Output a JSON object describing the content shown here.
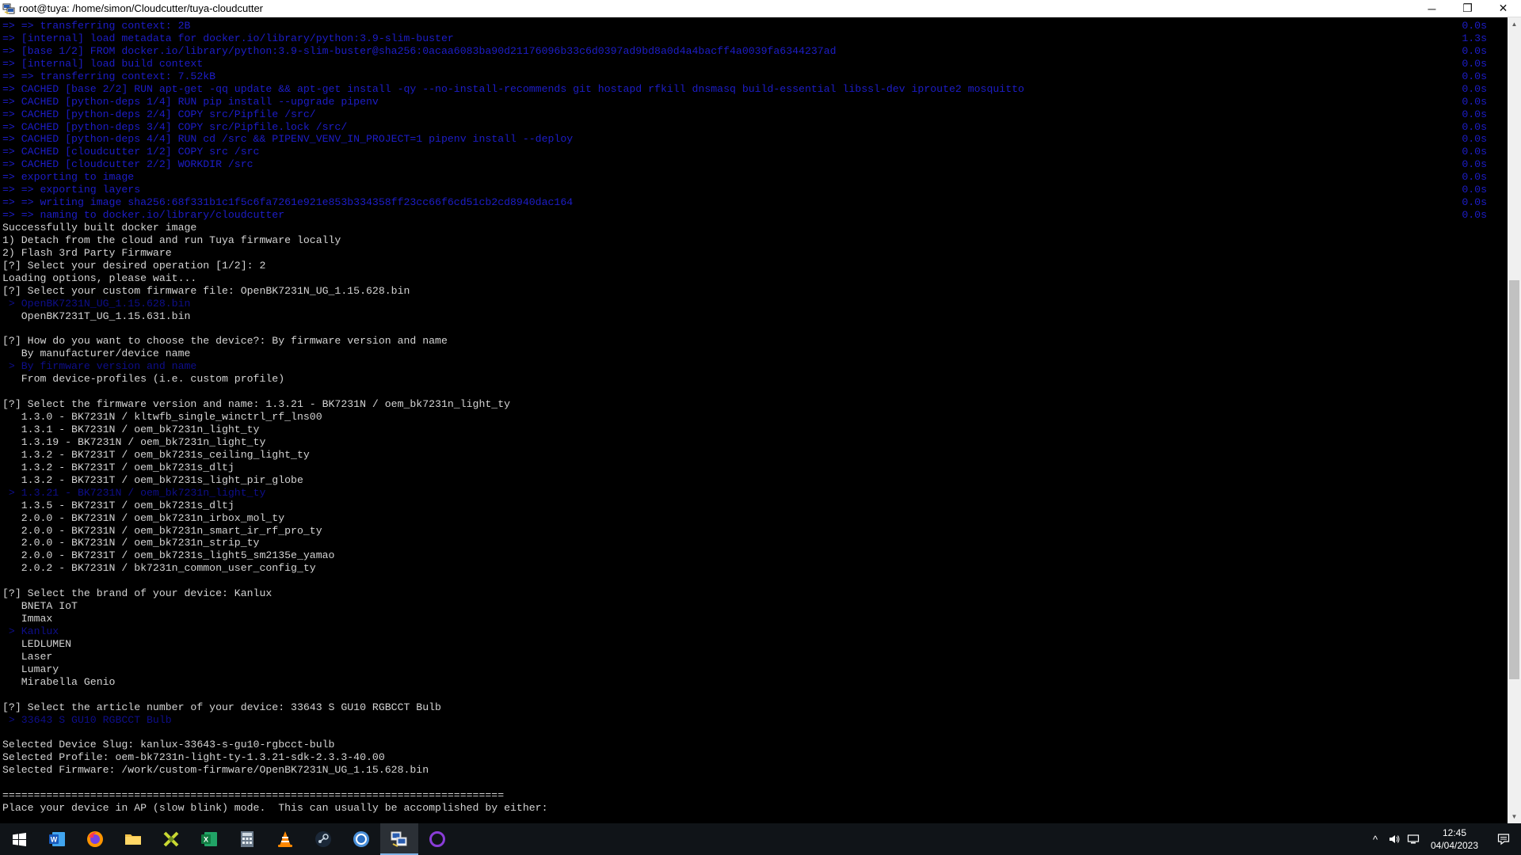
{
  "window": {
    "title": "root@tuya: /home/simon/Cloudcutter/tuya-cloudcutter",
    "minimize": "─",
    "restore": "❐",
    "close": "✕"
  },
  "terminal": {
    "lines": [
      {
        "text": "=> => transferring context: 2B",
        "time": "0.0s",
        "style": "blue"
      },
      {
        "text": "=> [internal] load metadata for docker.io/library/python:3.9-slim-buster",
        "time": "1.3s",
        "style": "blue"
      },
      {
        "text": "=> [base 1/2] FROM docker.io/library/python:3.9-slim-buster@sha256:0acaa6083ba90d21176096b33c6d0397ad9bd8a0d4a4bacff4a0039fa6344237ad",
        "time": "0.0s",
        "style": "blue"
      },
      {
        "text": "=> [internal] load build context",
        "time": "0.0s",
        "style": "blue"
      },
      {
        "text": "=> => transferring context: 7.52kB",
        "time": "0.0s",
        "style": "blue"
      },
      {
        "text": "=> CACHED [base 2/2] RUN apt-get -qq update && apt-get install -qy --no-install-recommends git hostapd rfkill dnsmasq build-essential libssl-dev iproute2 mosquitto",
        "time": "0.0s",
        "style": "blue"
      },
      {
        "text": "=> CACHED [python-deps 1/4] RUN pip install --upgrade pipenv",
        "time": "0.0s",
        "style": "blue"
      },
      {
        "text": "=> CACHED [python-deps 2/4] COPY src/Pipfile /src/",
        "time": "0.0s",
        "style": "blue"
      },
      {
        "text": "=> CACHED [python-deps 3/4] COPY src/Pipfile.lock /src/",
        "time": "0.0s",
        "style": "blue"
      },
      {
        "text": "=> CACHED [python-deps 4/4] RUN cd /src && PIPENV_VENV_IN_PROJECT=1 pipenv install --deploy",
        "time": "0.0s",
        "style": "blue"
      },
      {
        "text": "=> CACHED [cloudcutter 1/2] COPY src /src",
        "time": "0.0s",
        "style": "blue"
      },
      {
        "text": "=> CACHED [cloudcutter 2/2] WORKDIR /src",
        "time": "0.0s",
        "style": "blue"
      },
      {
        "text": "=> exporting to image",
        "time": "0.0s",
        "style": "blue"
      },
      {
        "text": "=> => exporting layers",
        "time": "0.0s",
        "style": "blue"
      },
      {
        "text": "=> => writing image sha256:68f331b1c1f5c6fa7261e921e853b334358ff23cc66f6cd51cb2cd8940dac164",
        "time": "0.0s",
        "style": "blue"
      },
      {
        "text": "=> => naming to docker.io/library/cloudcutter",
        "time": "0.0s",
        "style": "blue"
      },
      {
        "text": "Successfully built docker image",
        "time": "",
        "style": "normal"
      },
      {
        "text": "1) Detach from the cloud and run Tuya firmware locally",
        "time": "",
        "style": "normal"
      },
      {
        "text": "2) Flash 3rd Party Firmware",
        "time": "",
        "style": "normal"
      },
      {
        "text": "[?] Select your desired operation [1/2]: 2",
        "time": "",
        "style": "normal"
      },
      {
        "text": "Loading options, please wait...",
        "time": "",
        "style": "normal"
      },
      {
        "text": "[?] Select your custom firmware file: OpenBK7231N_UG_1.15.628.bin",
        "time": "",
        "style": "normal"
      },
      {
        "text": " > OpenBK7231N_UG_1.15.628.bin",
        "time": "",
        "style": "dim"
      },
      {
        "text": "   OpenBK7231T_UG_1.15.631.bin",
        "time": "",
        "style": "normal"
      },
      {
        "text": "",
        "time": "",
        "style": "normal"
      },
      {
        "text": "[?] How do you want to choose the device?: By firmware version and name",
        "time": "",
        "style": "normal"
      },
      {
        "text": "   By manufacturer/device name",
        "time": "",
        "style": "normal"
      },
      {
        "text": " > By firmware version and name",
        "time": "",
        "style": "dim"
      },
      {
        "text": "   From device-profiles (i.e. custom profile)",
        "time": "",
        "style": "normal"
      },
      {
        "text": "",
        "time": "",
        "style": "normal"
      },
      {
        "text": "[?] Select the firmware version and name: 1.3.21 - BK7231N / oem_bk7231n_light_ty",
        "time": "",
        "style": "normal"
      },
      {
        "text": "   1.3.0 - BK7231N / kltwfb_single_winctrl_rf_lns00",
        "time": "",
        "style": "normal"
      },
      {
        "text": "   1.3.1 - BK7231N / oem_bk7231n_light_ty",
        "time": "",
        "style": "normal"
      },
      {
        "text": "   1.3.19 - BK7231N / oem_bk7231n_light_ty",
        "time": "",
        "style": "normal"
      },
      {
        "text": "   1.3.2 - BK7231T / oem_bk7231s_ceiling_light_ty",
        "time": "",
        "style": "normal"
      },
      {
        "text": "   1.3.2 - BK7231T / oem_bk7231s_dltj",
        "time": "",
        "style": "normal"
      },
      {
        "text": "   1.3.2 - BK7231T / oem_bk7231s_light_pir_globe",
        "time": "",
        "style": "normal"
      },
      {
        "text": " > 1.3.21 - BK7231N / oem_bk7231n_light_ty",
        "time": "",
        "style": "dim"
      },
      {
        "text": "   1.3.5 - BK7231T / oem_bk7231s_dltj",
        "time": "",
        "style": "normal"
      },
      {
        "text": "   2.0.0 - BK7231N / oem_bk7231n_irbox_mol_ty",
        "time": "",
        "style": "normal"
      },
      {
        "text": "   2.0.0 - BK7231N / oem_bk7231n_smart_ir_rf_pro_ty",
        "time": "",
        "style": "normal"
      },
      {
        "text": "   2.0.0 - BK7231N / oem_bk7231n_strip_ty",
        "time": "",
        "style": "normal"
      },
      {
        "text": "   2.0.0 - BK7231T / oem_bk7231s_light5_sm2135e_yamao",
        "time": "",
        "style": "normal"
      },
      {
        "text": "   2.0.2 - BK7231N / bk7231n_common_user_config_ty",
        "time": "",
        "style": "normal"
      },
      {
        "text": "",
        "time": "",
        "style": "normal"
      },
      {
        "text": "[?] Select the brand of your device: Kanlux",
        "time": "",
        "style": "normal"
      },
      {
        "text": "   BNETA IoT",
        "time": "",
        "style": "normal"
      },
      {
        "text": "   Immax",
        "time": "",
        "style": "normal"
      },
      {
        "text": " > Kanlux",
        "time": "",
        "style": "dim"
      },
      {
        "text": "   LEDLUMEN",
        "time": "",
        "style": "normal"
      },
      {
        "text": "   Laser",
        "time": "",
        "style": "normal"
      },
      {
        "text": "   Lumary",
        "time": "",
        "style": "normal"
      },
      {
        "text": "   Mirabella Genio",
        "time": "",
        "style": "normal"
      },
      {
        "text": "",
        "time": "",
        "style": "normal"
      },
      {
        "text": "[?] Select the article number of your device: 33643 S GU10 RGBCCT Bulb",
        "time": "",
        "style": "normal"
      },
      {
        "text": " > 33643 S GU10 RGBCCT Bulb",
        "time": "",
        "style": "dim"
      },
      {
        "text": "",
        "time": "",
        "style": "normal"
      },
      {
        "text": "Selected Device Slug: kanlux-33643-s-gu10-rgbcct-bulb",
        "time": "",
        "style": "normal"
      },
      {
        "text": "Selected Profile: oem-bk7231n-light-ty-1.3.21-sdk-2.3.3-40.00",
        "time": "",
        "style": "normal"
      },
      {
        "text": "Selected Firmware: /work/custom-firmware/OpenBK7231N_UG_1.15.628.bin",
        "time": "",
        "style": "normal"
      },
      {
        "text": "",
        "time": "",
        "style": "normal"
      },
      {
        "text": "================================================================================",
        "time": "",
        "style": "normal"
      },
      {
        "text": "Place your device in AP (slow blink) mode.  This can usually be accomplished by either:",
        "time": "",
        "style": "normal"
      }
    ]
  },
  "scrollbar": {
    "up_arrow": "▲",
    "down_arrow": "▼"
  },
  "taskbar": {
    "apps": [
      {
        "name": "start-button",
        "icon": "windows-icon",
        "label": "Start"
      },
      {
        "name": "word-button",
        "icon": "word-icon",
        "label": "W"
      },
      {
        "name": "firefox-button",
        "icon": "firefox-icon",
        "label": ""
      },
      {
        "name": "file-explorer-button",
        "icon": "folder-icon",
        "label": ""
      },
      {
        "name": "app-button",
        "icon": "app-icon",
        "label": ""
      },
      {
        "name": "excel-button",
        "icon": "excel-icon",
        "label": "X"
      },
      {
        "name": "calculator-button",
        "icon": "calculator-icon",
        "label": ""
      },
      {
        "name": "vlc-button",
        "icon": "vlc-icon",
        "label": ""
      },
      {
        "name": "steam-button",
        "icon": "steam-icon",
        "label": ""
      },
      {
        "name": "chrome-button",
        "icon": "chrome-icon",
        "label": ""
      },
      {
        "name": "terminal-button",
        "icon": "putty-icon",
        "label": ""
      },
      {
        "name": "cortana-button",
        "icon": "cortana-icon",
        "label": ""
      }
    ],
    "active_app": "terminal-button",
    "tray": {
      "chevron": "^",
      "volume": "🔊",
      "network": "🖵",
      "time": "12:45",
      "date": "04/04/2023"
    }
  },
  "colors": {
    "terminal_bg": "#000000",
    "terminal_text": "#d4d4d4",
    "terminal_blue": "#1d1dc8",
    "taskbar_bg": "#101418",
    "accent": "#7fb2e5"
  }
}
